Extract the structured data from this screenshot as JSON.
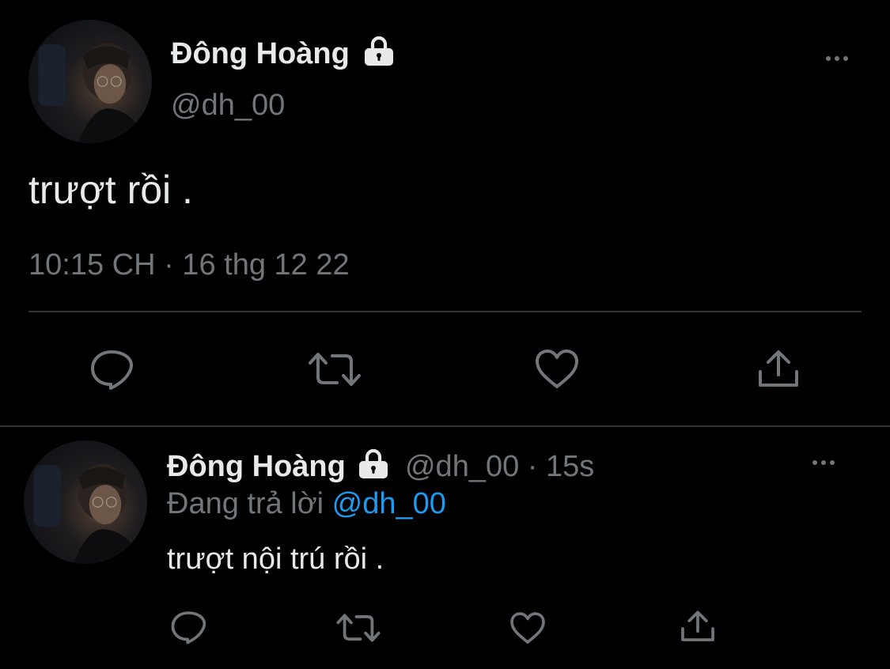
{
  "main_tweet": {
    "author_name": "Đông Hoàng",
    "handle": "@dh_00",
    "text": "trượt rồi .",
    "timestamp": "10:15 CH · 16 thg 12 22"
  },
  "reply_tweet": {
    "author_name": "Đông Hoàng",
    "handle": "@dh_00",
    "separator": "·",
    "age": "15s",
    "replying_prefix": "Đang trả lời",
    "replying_to": "@dh_00",
    "text": "trượt nội trú rồi ."
  },
  "icons": {
    "lock": "lock-icon",
    "more": "more-icon",
    "reply": "reply-icon",
    "retweet": "retweet-icon",
    "like": "like-icon",
    "share": "share-icon"
  },
  "colors": {
    "background": "#000000",
    "text": "#e7e9ea",
    "muted": "#71767b",
    "link": "#1d9bf0",
    "divider": "#2f3336"
  }
}
